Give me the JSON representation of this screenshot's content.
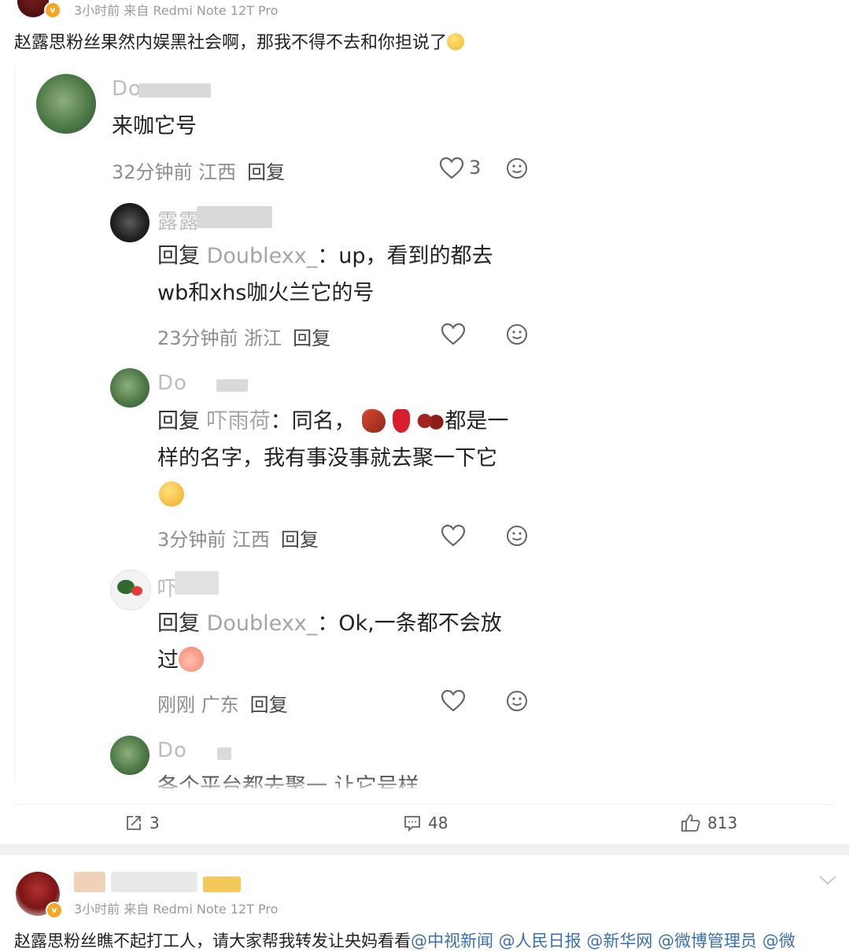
{
  "post1": {
    "meta": "3小时前  来自 Redmi Note 12T Pro",
    "text": "赵露思粉丝果然内娱黑社会啊，那我不得不去和你担说了",
    "comments": [
      {
        "user": "Do",
        "text": "来咖它号",
        "time_loc": "32分钟前 江西",
        "reply_label": "回复",
        "likes": "3"
      },
      {
        "user": "露露",
        "reply_prefix": "回复",
        "reply_to": "Doublexx_",
        "text_line1": "：up，看到的都去",
        "text_line2": "wb和xhs咖火兰它的号",
        "time_loc": "23分钟前 浙江",
        "reply_label": "回复"
      },
      {
        "user": "Do",
        "reply_prefix": "回复",
        "reply_to": "吓雨荷",
        "text_line1a": "：同名，",
        "text_line1b": "都是一",
        "text_line2": "样的名字，我有事没事就去聚一下它",
        "time_loc": "3分钟前 江西",
        "reply_label": "回复"
      },
      {
        "user": "吓",
        "reply_prefix": "回复",
        "reply_to": "Doublexx_",
        "text_line1": "：Ok,一条都不会放",
        "text_line2": "过",
        "time_loc": "刚刚 广东",
        "reply_label": "回复"
      },
      {
        "user": "Do",
        "text": "各个平台都去聚一 让它号样"
      }
    ],
    "toolbar": {
      "repost_count": "3",
      "comment_count": "48",
      "like_count": "813"
    }
  },
  "post2": {
    "meta": "3小时前  来自 Redmi Note 12T Pro",
    "text_plain": "赵露思粉丝瞧不起打工人，请大家帮我转发让央妈看看",
    "mentions": "@中视新闻 @人民日报 @新华网 @微博管理员 @微"
  },
  "colors": {
    "mention": "#a5a5a5",
    "link": "#3b6fb4",
    "verified": "#f5a623"
  }
}
